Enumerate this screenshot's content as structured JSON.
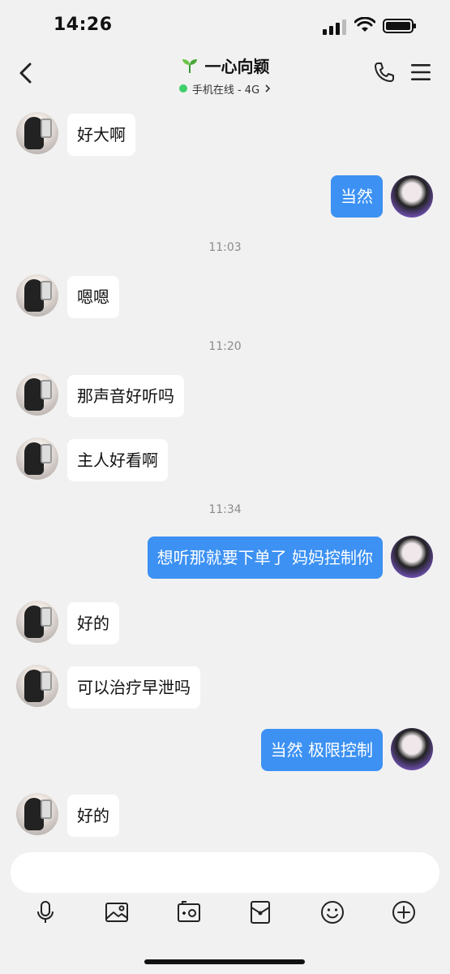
{
  "status_bar": {
    "time": "14:26"
  },
  "header": {
    "title": "一心向颖",
    "subtitle": "手机在线 - 4G",
    "colors": {
      "online": "#3fd06a"
    }
  },
  "chat": {
    "colors": {
      "outgoing_bubble": "#3c91f3",
      "incoming_bubble": "#ffffff"
    },
    "messages": [
      {
        "side": "in",
        "text": "好大啊"
      },
      {
        "side": "out",
        "text": "当然"
      },
      {
        "side": "time",
        "text": "11:03"
      },
      {
        "side": "in",
        "text": "嗯嗯"
      },
      {
        "side": "time",
        "text": "11:20"
      },
      {
        "side": "in",
        "text": "那声音好听吗"
      },
      {
        "side": "in",
        "text": "主人好看啊"
      },
      {
        "side": "time",
        "text": "11:34"
      },
      {
        "side": "out",
        "text": "想听那就要下单了 妈妈控制你"
      },
      {
        "side": "in",
        "text": "好的"
      },
      {
        "side": "in",
        "text": "可以治疗早泄吗"
      },
      {
        "side": "out",
        "text": "当然 极限控制"
      },
      {
        "side": "in",
        "text": "好的"
      }
    ]
  },
  "input": {
    "placeholder": ""
  },
  "toolbar": {
    "icons": [
      "microphone-icon",
      "image-icon",
      "camera-icon",
      "red-packet-icon",
      "emoji-icon",
      "plus-icon"
    ]
  }
}
